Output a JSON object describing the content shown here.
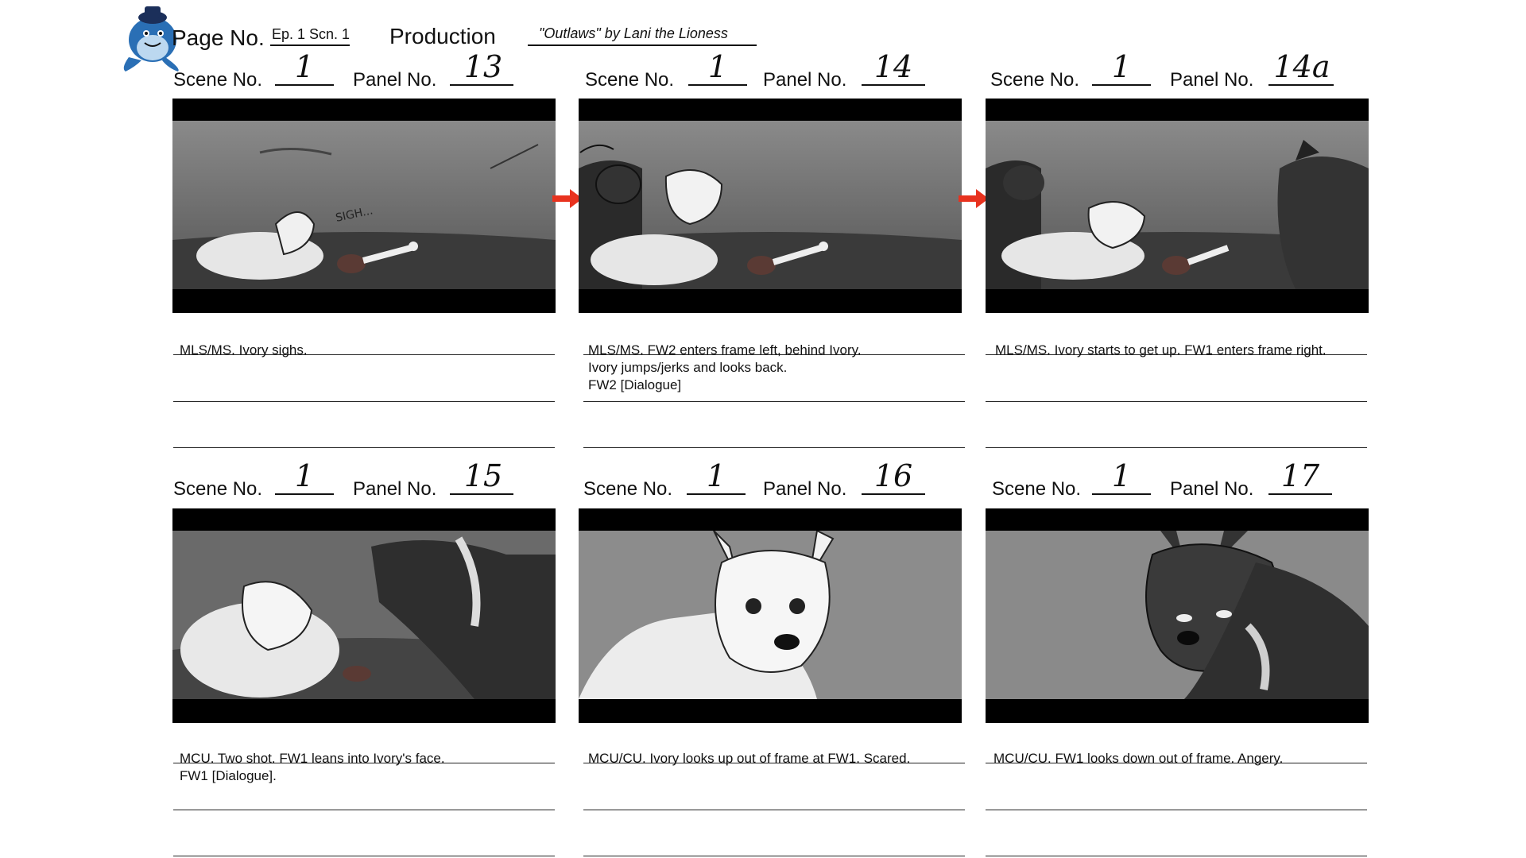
{
  "header": {
    "page_label": "Page No.",
    "page_value": "Ep. 1 Scn. 1",
    "production_label": "Production",
    "production_value": "\"Outlaws\" by Lani the Lioness",
    "logo_icon": "whale-mascot-icon"
  },
  "labels": {
    "scene": "Scene No.",
    "panel": "Panel No."
  },
  "panels": [
    {
      "scene": "1",
      "panel": "13",
      "lines": [
        "MLS/MS. Ivory sighs."
      ],
      "sfx": "SIGH..."
    },
    {
      "scene": "1",
      "panel": "14",
      "lines": [
        "MLS/MS. FW2 enters frame left, behind Ivory.",
        "Ivory jumps/jerks and looks back.",
        "FW2 [Dialogue]"
      ]
    },
    {
      "scene": "1",
      "panel": "14a",
      "lines": [
        "MLS/MS. Ivory starts to get up. FW1 enters frame right."
      ]
    },
    {
      "scene": "1",
      "panel": "15",
      "lines": [
        "MCU. Two shot. FW1 leans into Ivory's face.",
        "FW1 [Dialogue]."
      ]
    },
    {
      "scene": "1",
      "panel": "16",
      "lines": [
        "MCU/CU. Ivory looks up out of frame at FW1. Scared."
      ]
    },
    {
      "scene": "1",
      "panel": "17",
      "lines": [
        "MCU/CU. FW1 looks down out of frame. Angery."
      ]
    }
  ],
  "colors": {
    "transition_arrow": "#e8321e",
    "frame_border": "#000000"
  }
}
